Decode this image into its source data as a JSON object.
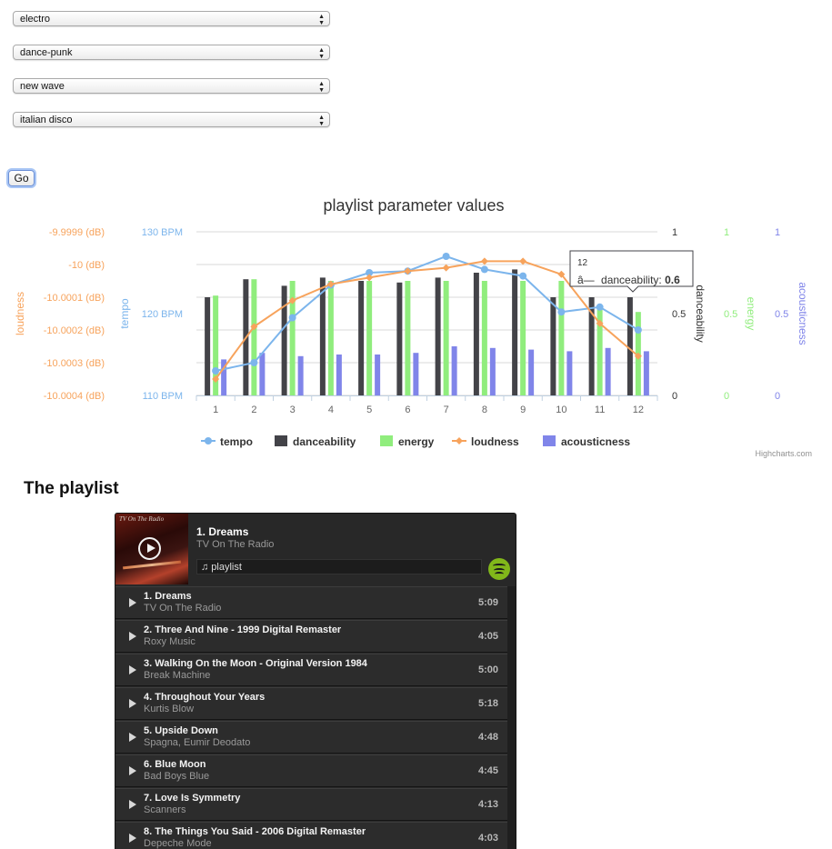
{
  "selects": [
    {
      "value": "electro"
    },
    {
      "value": "dance-punk"
    },
    {
      "value": "new wave"
    },
    {
      "value": "italian disco"
    }
  ],
  "go_label": "Go",
  "colors": {
    "tempo": "#7cb5ec",
    "danceability": "#434348",
    "energy": "#90ed7d",
    "loudness": "#f7a35c",
    "acousticness": "#8085e9"
  },
  "chart_data": {
    "type": "bar",
    "title": "playlist parameter values",
    "categories": [
      "1",
      "2",
      "3",
      "4",
      "5",
      "6",
      "7",
      "8",
      "9",
      "10",
      "11",
      "12"
    ],
    "axes": {
      "loudness": {
        "title": "loudness",
        "ticks": [
          "-9.9999 (dB)",
          "-10 (dB)",
          "-10.0001 (dB)",
          "-10.0002 (dB)",
          "-10.0003 (dB)",
          "-10.0004 (dB)"
        ]
      },
      "tempo": {
        "title": "tempo",
        "ticks": [
          "130 BPM",
          "120 BPM",
          "110 BPM"
        ]
      },
      "danceability": {
        "title": "danceability",
        "ticks": [
          "1",
          "0.5",
          "0"
        ]
      },
      "energy": {
        "title": "energy",
        "ticks": [
          "1",
          "0.5",
          "0"
        ]
      },
      "acousticness": {
        "title": "acousticness",
        "ticks": [
          "1",
          "0.5",
          "0"
        ]
      }
    },
    "series": [
      {
        "name": "tempo",
        "type": "line",
        "values": [
          113,
          114,
          119.5,
          123.5,
          125,
          125.2,
          127,
          125.4,
          124.6,
          120.2,
          120.8,
          118
        ]
      },
      {
        "name": "danceability",
        "type": "bar",
        "values": [
          0.6,
          0.71,
          0.67,
          0.72,
          0.7,
          0.69,
          0.72,
          0.75,
          0.77,
          0.6,
          0.6,
          0.6
        ]
      },
      {
        "name": "energy",
        "type": "bar",
        "values": [
          0.61,
          0.71,
          0.7,
          0.7,
          0.7,
          0.7,
          0.7,
          0.7,
          0.7,
          0.7,
          0.55,
          0.51
        ]
      },
      {
        "name": "loudness",
        "type": "line",
        "values": [
          -10.00035,
          -10.00019,
          -10.00011,
          -10.00006,
          -10.00004,
          -10.00002,
          -10.00001,
          -9.99999,
          -9.99999,
          -10.00003,
          -10.00018,
          -10.00028
        ]
      },
      {
        "name": "acousticness",
        "type": "bar",
        "values": [
          0.22,
          0.26,
          0.24,
          0.25,
          0.25,
          0.26,
          0.3,
          0.29,
          0.28,
          0.27,
          0.29,
          0.27
        ]
      }
    ],
    "legend": [
      "tempo",
      "danceability",
      "energy",
      "loudness",
      "acousticness"
    ],
    "legend_position": "bottom",
    "tooltip": {
      "title": "12",
      "series": "danceability",
      "value": "0.6",
      "marker": "â—"
    },
    "credits": "Highcharts.com"
  },
  "playlist": {
    "heading": "The playlist",
    "now_playing": {
      "title": "1. Dreams",
      "artist": "TV On The Radio",
      "playlist_label": "♫ playlist",
      "art_text": "TV On The Radio"
    },
    "tracks": [
      {
        "title": "1. Dreams",
        "artist": "TV On The Radio",
        "duration": "5:09"
      },
      {
        "title": "2. Three And Nine - 1999 Digital Remaster",
        "artist": "Roxy Music",
        "duration": "4:05"
      },
      {
        "title": "3. Walking On the Moon - Original Version 1984",
        "artist": "Break Machine",
        "duration": "5:00"
      },
      {
        "title": "4. Throughout Your Years",
        "artist": "Kurtis Blow",
        "duration": "5:18"
      },
      {
        "title": "5. Upside Down",
        "artist": "Spagna, Eumir Deodato",
        "duration": "4:48"
      },
      {
        "title": "6. Blue Moon",
        "artist": "Bad Boys Blue",
        "duration": "4:45"
      },
      {
        "title": "7. Love Is Symmetry",
        "artist": "Scanners",
        "duration": "4:13"
      },
      {
        "title": "8. The Things You Said - 2006 Digital Remaster",
        "artist": "Depeche Mode",
        "duration": "4:03"
      }
    ]
  }
}
